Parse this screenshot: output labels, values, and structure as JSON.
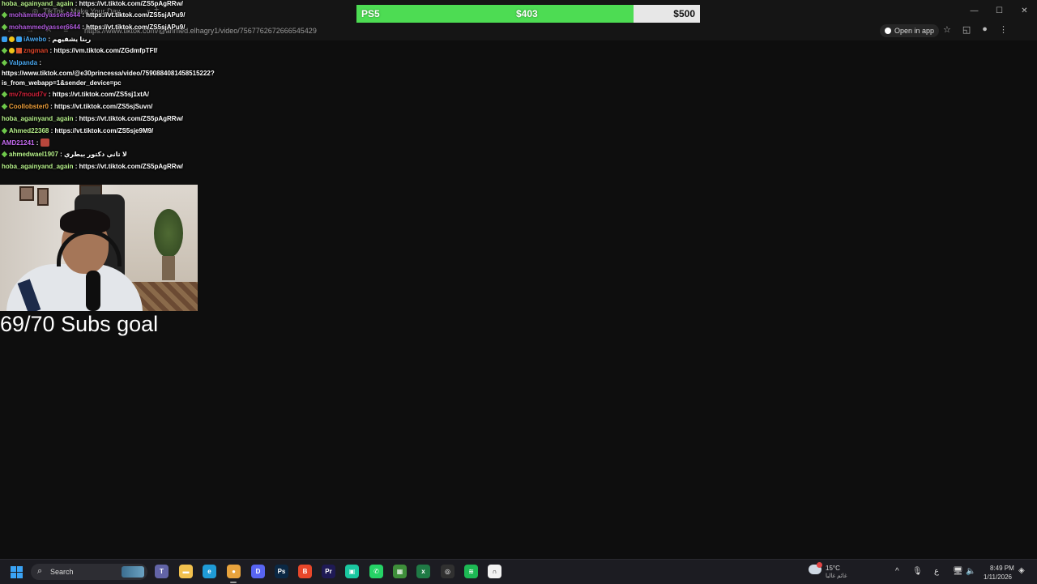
{
  "browser": {
    "tab_title": "TikTok - Make Your Day",
    "tab_close": "×",
    "new_tab": "+",
    "url": "https://www.tiktok.com/@ahmed.elhagry1/video/7567762672666545429",
    "open_in_app": "Open in app",
    "window_controls": [
      "—",
      "☐",
      "✕"
    ]
  },
  "goal_bar": {
    "label": "PS5",
    "current": "$403",
    "target": "$500",
    "progress": 0.806,
    "fill_color": "#4ddc53"
  },
  "chat": [
    {
      "badges": [],
      "user": "hoba_againyand_again",
      "user_color": "#b6f08a",
      "text": "https://vt.tiktok.com/ZS5pAgRRw/"
    },
    {
      "badges": [
        "green"
      ],
      "user": "mohammedyasser6644",
      "user_color": "#b05bdc",
      "text": "https://vt.tiktok.com/ZS5sjAPu9/"
    },
    {
      "badges": [
        "green"
      ],
      "user": "mohammedyasser6644",
      "user_color": "#b05bdc",
      "text": "https://vt.tiktok.com/ZS5sjAPu9/"
    },
    {
      "badges": [
        "blue",
        "yellow",
        "blue"
      ],
      "user": "iAwebo",
      "user_color": "#4aa8f0",
      "text": "ربنا يشفيهم"
    },
    {
      "badges": [
        "green",
        "yellow",
        "red"
      ],
      "user": "zngman",
      "user_color": "#e0462b",
      "text": "https://vm.tiktok.com/ZGdmfpTFf/"
    },
    {
      "badges": [
        "green"
      ],
      "user": "Valpanda",
      "user_color": "#4aa8f0",
      "text": ""
    },
    {
      "badges": [],
      "user": "",
      "user_color": "#ffffff",
      "text": "https://www.tiktok.com/@e30princessa/video/7590884081458515222?"
    },
    {
      "badges": [],
      "user": "",
      "user_color": "#ffffff",
      "text": "is_from_webapp=1&sender_device=pc"
    },
    {
      "badges": [
        "green"
      ],
      "user": "mv7moud7v",
      "user_color": "#d0223a",
      "text": "https://vt.tiktok.com/ZS5sj1xtA/"
    },
    {
      "badges": [
        "green"
      ],
      "user": "Coollobster0",
      "user_color": "#f0a03a",
      "text": "https://vt.tiktok.com/ZS5sjSuvn/"
    },
    {
      "badges": [],
      "user": "hoba_againyand_again",
      "user_color": "#b6f08a",
      "text": "https://vt.tiktok.com/ZS5pAgRRw/"
    },
    {
      "badges": [
        "green"
      ],
      "user": "Ahmed22368",
      "user_color": "#b6f08a",
      "text": "https://vt.tiktok.com/ZS5sje9M9/"
    },
    {
      "badges": [],
      "user": "AMD21241",
      "user_color": "#c56bf0",
      "text": "",
      "emote": "emote"
    },
    {
      "badges": [
        "green"
      ],
      "user": "ahmedwael1907",
      "user_color": "#b6f08a",
      "text": "لا تاني دكتور بيطري"
    },
    {
      "badges": [],
      "user": "hoba_againyand_again",
      "user_color": "#b6f08a",
      "text": "https://vt.tiktok.com/ZS5pAgRRw/"
    }
  ],
  "subs_goal": "69/70 Subs goal",
  "taskbar": {
    "search_label": "Search",
    "apps": [
      {
        "name": "teams",
        "glyph": "T",
        "color": "#6264a7"
      },
      {
        "name": "file-explorer",
        "glyph": "▬",
        "color": "#f2c14e"
      },
      {
        "name": "edge",
        "glyph": "e",
        "color": "#1f9bd6"
      },
      {
        "name": "chrome",
        "glyph": "●",
        "color": "#e8a33d"
      },
      {
        "name": "discord",
        "glyph": "D",
        "color": "#5865f2"
      },
      {
        "name": "photoshop",
        "glyph": "Ps",
        "color": "#0b2844"
      },
      {
        "name": "brave",
        "glyph": "B",
        "color": "#e8472a"
      },
      {
        "name": "premiere",
        "glyph": "Pr",
        "color": "#1f1a55"
      },
      {
        "name": "streamlabs",
        "glyph": "▣",
        "color": "#1ac7a0"
      },
      {
        "name": "whatsapp",
        "glyph": "✆",
        "color": "#25d366"
      },
      {
        "name": "minecraft",
        "glyph": "▦",
        "color": "#3e8f3a"
      },
      {
        "name": "excel",
        "glyph": "x",
        "color": "#1f7a45"
      },
      {
        "name": "obs",
        "glyph": "◎",
        "color": "#303030"
      },
      {
        "name": "spotify",
        "glyph": "≋",
        "color": "#1db954"
      },
      {
        "name": "capcut",
        "glyph": "∩",
        "color": "#f2f2f2"
      }
    ],
    "weather_temp": "15°C",
    "weather_desc": "غائم غالبا",
    "tray": [
      "^",
      "🎙",
      "ع",
      "🖥",
      "🔈",
      "🔋"
    ],
    "time": "8:49 PM",
    "date": "1/11/2026"
  }
}
